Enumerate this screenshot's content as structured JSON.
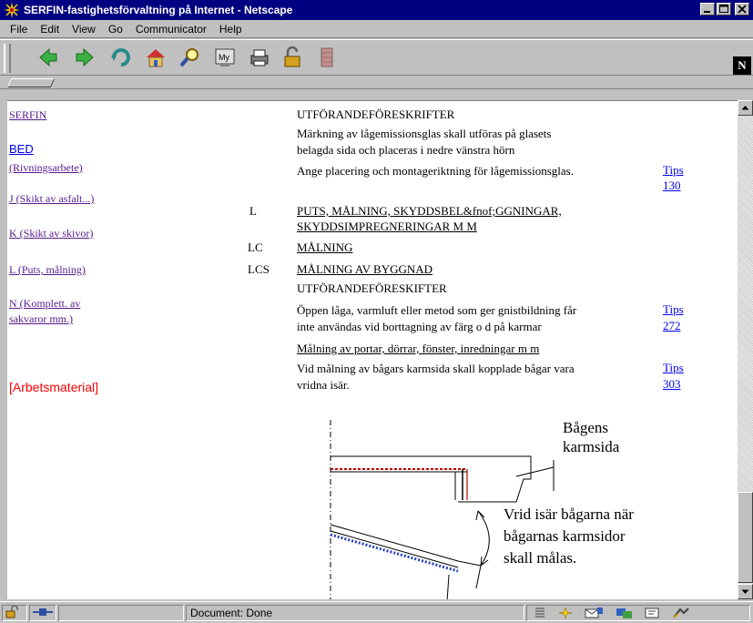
{
  "window": {
    "title": "SERFIN-fastighetsförvaltning på Internet - Netscape",
    "controls": [
      "minimize",
      "maximize",
      "close"
    ]
  },
  "menu": [
    "File",
    "Edit",
    "View",
    "Go",
    "Communicator",
    "Help"
  ],
  "toolbar": {
    "buttons": [
      "back-icon",
      "forward-icon",
      "reload-icon",
      "home-icon",
      "search-icon",
      "my-netscape-icon",
      "print-icon",
      "security-icon",
      "stop-icon"
    ],
    "logo": "N"
  },
  "sidebar": {
    "links": [
      {
        "label": "SERFIN",
        "style": "visited"
      },
      {
        "label": "BED",
        "style": "link"
      },
      {
        "label": "(Rivningsarbete)",
        "style": "visited"
      },
      {
        "label": "J (Skikt av asfalt...)",
        "style": "visited"
      },
      {
        "label": "K (Skikt av skivor)",
        "style": "visited"
      },
      {
        "label": "L (Puts, målning)",
        "style": "visited"
      },
      {
        "label": "N (Komplett. av",
        "style": "visited"
      },
      {
        "label": "sakvaror mm.)",
        "style": "visited"
      }
    ],
    "material": "[Arbetsmaterial]"
  },
  "main": {
    "heading1": "UTFÖRANDEFÖRESKRIFTER",
    "para1_l1": "Märkning av lågemissionsglas skall utföras på glasets",
    "para1_l2": "belagda sida och placeras i nedre vänstra hörn",
    "para2": "Ange placering och montageriktning för lågemissionsglas.",
    "tips1": "Tips",
    "tips1_num": "130",
    "code_l": "L",
    "title_l_1": "PUTS, MÅLNING, SKYDDSBEL&fnof;GGNINGAR,",
    "title_l_2": "SKYDDSIMPREGNERINGAR M M",
    "code_lc": "LC",
    "title_lc": "MÅLNING",
    "code_lcs": "LCS",
    "title_lcs": "MÅLNING AV BYGGNAD",
    "heading2": "UTFÖRANDEFÖRESKIFTER",
    "para3_l1": "Öppen låga, varmluft eller metod som ger gnistbildning får",
    "para3_l2": "inte användas vid borttagning av färg o d på karmar",
    "tips2": "Tips",
    "tips2_num": "272",
    "subheading": "Målning av portar, dörrar, fönster, inredningar m m",
    "para4_l1": "Vid målning av bågars karmsida skall kopplade bågar vara",
    "para4_l2": "vridna isär.",
    "tips3": "Tips",
    "tips3_num": "303"
  },
  "figure": {
    "label1_l1": "Bågens",
    "label1_l2": "karmsida",
    "label2_l1": "Vrid isär bågarna när",
    "label2_l2": "bågarnas karmsidor",
    "label2_l3": "skall målas."
  },
  "status": {
    "text": "Document: Done"
  },
  "colors": {
    "titlebar": "#000080",
    "visited_link": "#551a8b",
    "link": "#0000ee",
    "material": "#ff0000"
  }
}
